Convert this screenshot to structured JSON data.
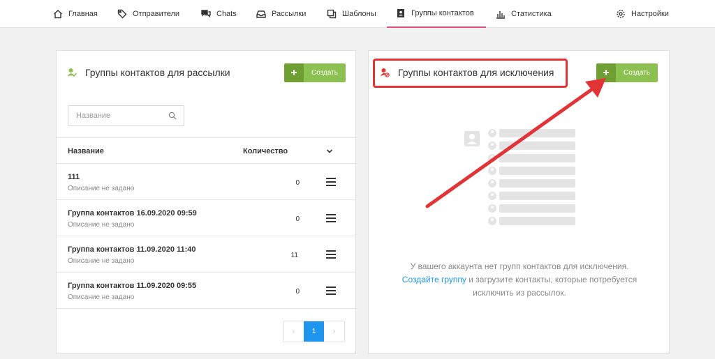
{
  "nav": {
    "items": [
      {
        "label": "Главная",
        "icon": "home-icon"
      },
      {
        "label": "Отправители",
        "icon": "tag-icon"
      },
      {
        "label": "Chats",
        "icon": "chat-icon"
      },
      {
        "label": "Рассылки",
        "icon": "inbox-icon"
      },
      {
        "label": "Шаблоны",
        "icon": "copy-icon"
      },
      {
        "label": "Группы контактов",
        "icon": "contacts-book-icon",
        "active": true
      },
      {
        "label": "Статистика",
        "icon": "bar-chart-icon"
      }
    ],
    "settings_label": "Настройки"
  },
  "left_panel": {
    "title": "Группы контактов для рассылки",
    "create_label": "Создать",
    "search_placeholder": "Название",
    "columns": {
      "name": "Название",
      "count": "Количество"
    },
    "rows": [
      {
        "name": "111",
        "desc": "Описание не задано",
        "count": "0"
      },
      {
        "name": "Группа контактов 16.09.2020 09:59",
        "desc": "Описание не задано",
        "count": "0"
      },
      {
        "name": "Группа контактов 11.09.2020 11:40",
        "desc": "Описание не задано",
        "count": "11"
      },
      {
        "name": "Группа контактов 11.09.2020 09:55",
        "desc": "Описание не задано",
        "count": "0"
      }
    ],
    "pagination": {
      "prev": "‹",
      "current": "1",
      "next": "›"
    }
  },
  "right_panel": {
    "title": "Группы контактов для исключения",
    "create_label": "Создать",
    "empty_line1": "У вашего аккаунта нет групп контактов для исключения.",
    "empty_link": "Создайте группу",
    "empty_line2_rest": " и загрузите контакты, которые потребуется",
    "empty_line3": "исключить из рассылок."
  },
  "colors": {
    "accent_green": "#8cc152",
    "accent_green_dark": "#6f9f32",
    "active_tab": "#e0517f",
    "link_blue": "#1e96f0",
    "highlight_red": "#e23336"
  }
}
